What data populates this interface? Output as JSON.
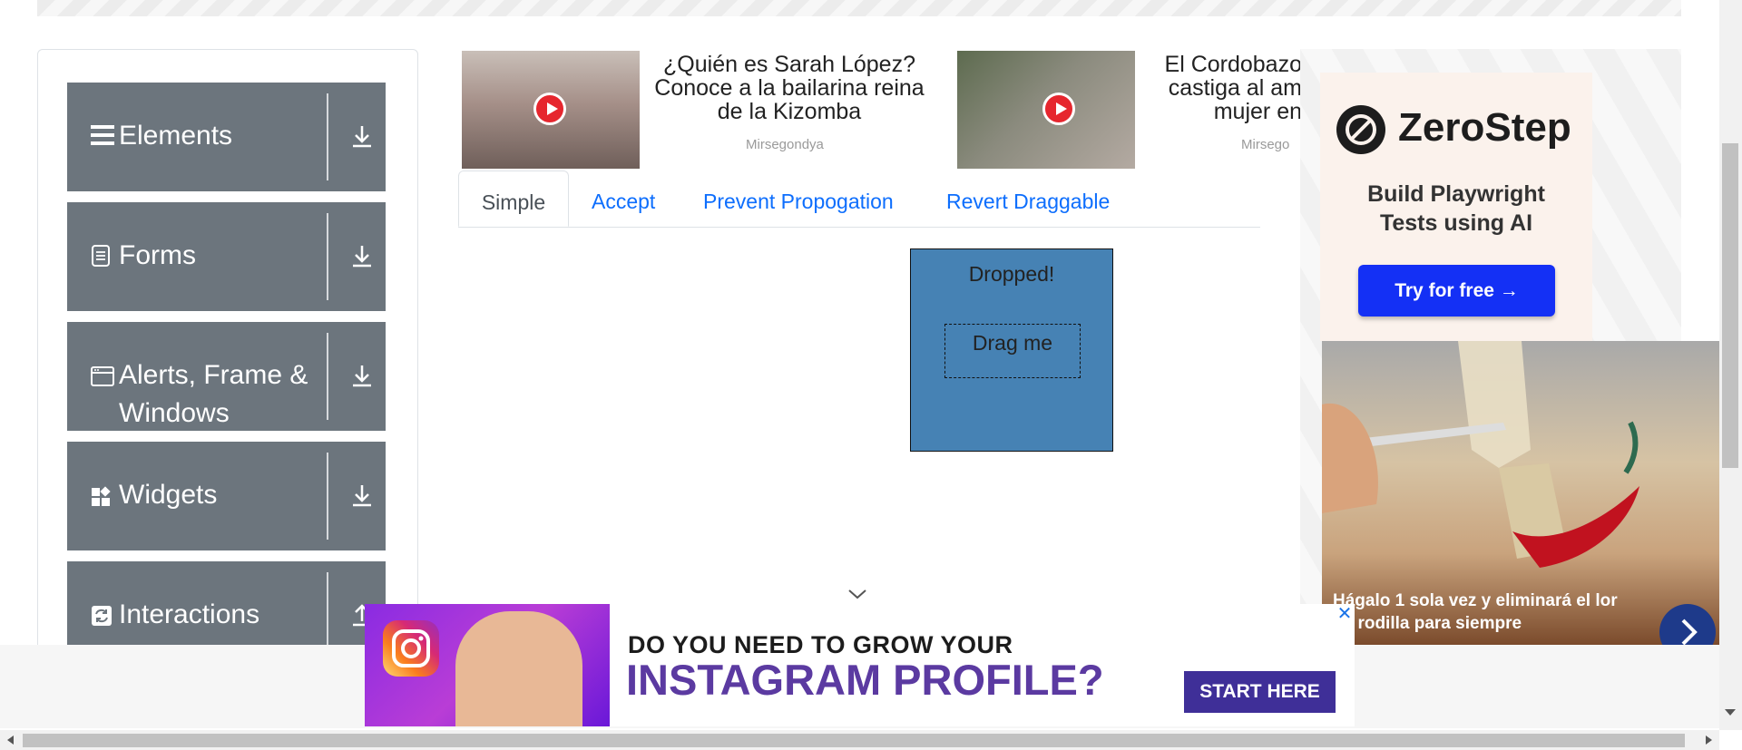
{
  "sidebar": {
    "groups": [
      {
        "label": "Elements",
        "icon": "hamburger-icon",
        "expand_icon": "download-arrow-icon"
      },
      {
        "label": "Forms",
        "icon": "document-icon",
        "expand_icon": "download-arrow-icon"
      },
      {
        "label_line1": "Alerts, Frame &",
        "label_line2": "Windows",
        "icon": "window-icon",
        "expand_icon": "download-arrow-icon"
      },
      {
        "label": "Widgets",
        "icon": "widgets-icon",
        "expand_icon": "download-arrow-icon"
      },
      {
        "label": "Interactions",
        "icon": "interactions-icon",
        "expand_icon": "upload-arrow-icon"
      }
    ]
  },
  "top_ads": [
    {
      "title": "¿Quién es Sarah López? Conoce a la bailarina reina de la Kizomba",
      "source": "Mirsegondya"
    },
    {
      "title": "El Cordobazo castiga al am mujer en",
      "source": "Mirsego"
    }
  ],
  "tabs": [
    {
      "label": "Simple",
      "active": true
    },
    {
      "label": "Accept",
      "active": false
    },
    {
      "label": "Prevent Propogation",
      "active": false
    },
    {
      "label": "Revert Draggable",
      "active": false
    }
  ],
  "droppable": {
    "drop_text": "Dropped!",
    "drag_text": "Drag me",
    "color": "#4682b4"
  },
  "right_ad": {
    "brand": "ZeroStep",
    "tagline_line1": "Build Playwright",
    "tagline_line2": "Tests using AI",
    "button": "Try for free →"
  },
  "knee_ad": {
    "caption": "Hágalo 1 sola vez y eliminará el lor de rodilla para siempre"
  },
  "bottom_ad": {
    "line1": "DO YOU NEED TO GROW YOUR",
    "line2": "INSTAGRAM PROFILE?",
    "button": "START HERE",
    "close": "✕"
  },
  "colors": {
    "sidebar_bg": "#6c757d",
    "tab_link": "#0d6efd",
    "zerostep_button": "#1430f5",
    "instagram_purple": "#5b3aa1"
  }
}
